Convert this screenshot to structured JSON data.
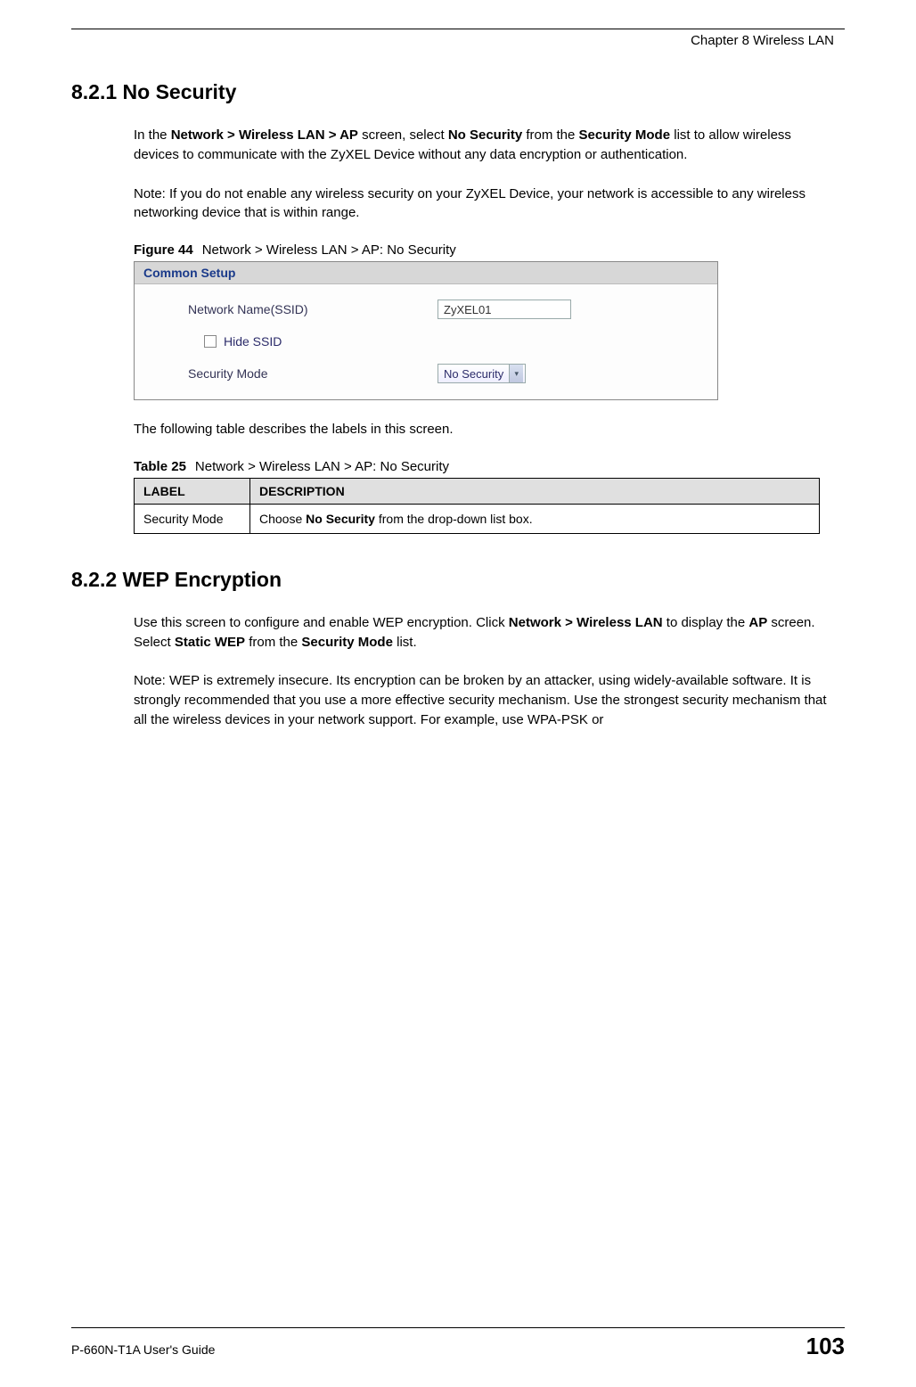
{
  "chapter_header": "Chapter 8 Wireless LAN",
  "section_821": {
    "heading": "8.2.1  No Security",
    "para_parts": [
      "In the ",
      "Network > Wireless LAN > AP",
      " screen, select ",
      "No Security",
      " from the ",
      "Security Mode",
      " list to allow wireless devices to communicate with the ZyXEL Device without any data encryption or authentication."
    ],
    "note": "Note: If you do not enable any wireless security on your ZyXEL Device, your network is accessible to any wireless networking device that is within range."
  },
  "figure44": {
    "lead": "Figure 44",
    "caption": "Network > Wireless LAN > AP: No Security",
    "common_setup": "Common Setup",
    "ssid_label": "Network Name(SSID)",
    "ssid_value": "ZyXEL01",
    "hide_ssid_label": " Hide SSID",
    "security_mode_label": "Security Mode",
    "security_mode_value": "No Security"
  },
  "post_figure_text": "The following table describes the labels in this screen.",
  "table25": {
    "lead": "Table 25",
    "caption": "Network > Wireless LAN > AP: No Security",
    "header_label": "LABEL",
    "header_desc": "DESCRIPTION",
    "row_label": "Security Mode",
    "row_desc_parts": [
      "Choose ",
      "No Security",
      " from the drop-down list box."
    ]
  },
  "section_822": {
    "heading": "8.2.2  WEP Encryption",
    "para_parts": [
      "Use this screen to configure and enable WEP encryption. Click ",
      "Network > Wireless LAN",
      " to display the ",
      "AP",
      " screen. Select ",
      "Static WEP",
      " from the ",
      "Security Mode",
      " list."
    ],
    "note": "Note: WEP is extremely insecure. Its encryption can be broken by an attacker, using widely-available software. It is strongly recommended that you use a more effective security mechanism. Use the strongest security mechanism that all the wireless devices in your network support. For example, use WPA-PSK or"
  },
  "footer": {
    "guide": "P-660N-T1A User's Guide",
    "page": "103"
  }
}
